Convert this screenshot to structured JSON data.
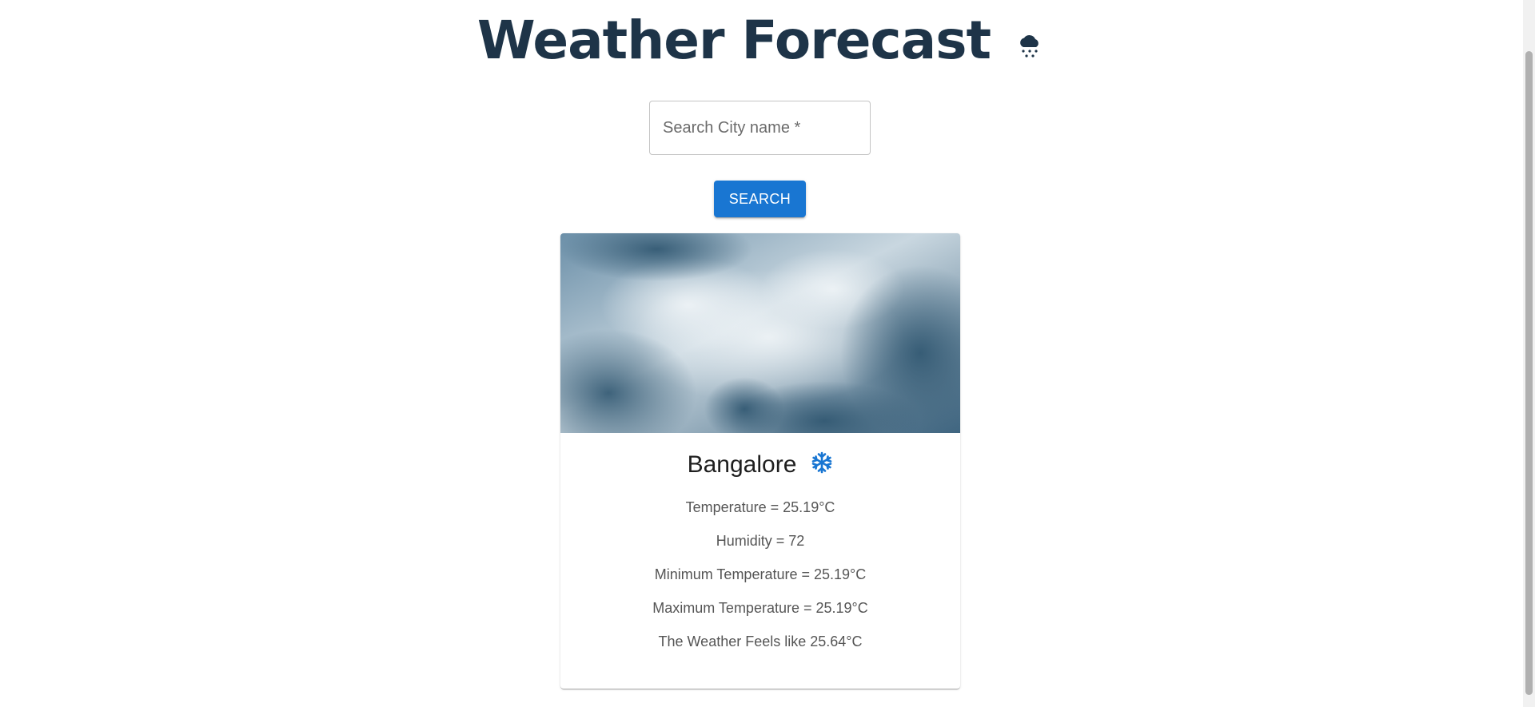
{
  "header": {
    "title": "Weather Forecast",
    "title_icon": "cloud-snow-icon"
  },
  "search": {
    "placeholder": "Search City name *",
    "value": "",
    "button_label": "SEARCH"
  },
  "card": {
    "image": "cloudy-sky-photo",
    "city": "Bangalore",
    "condition_icon": "snowflake-icon",
    "details": {
      "temperature": "Temperature = 25.19°C",
      "humidity": "Humidity = 72",
      "min_temperature": "Minimum Temperature = 25.19°C",
      "max_temperature": "Maximum Temperature = 25.19°C",
      "feels_like": "The Weather Feels like 25.64°C"
    }
  },
  "colors": {
    "title": "#1e3448",
    "accent": "#1976d2",
    "detail_text": "#555555"
  }
}
